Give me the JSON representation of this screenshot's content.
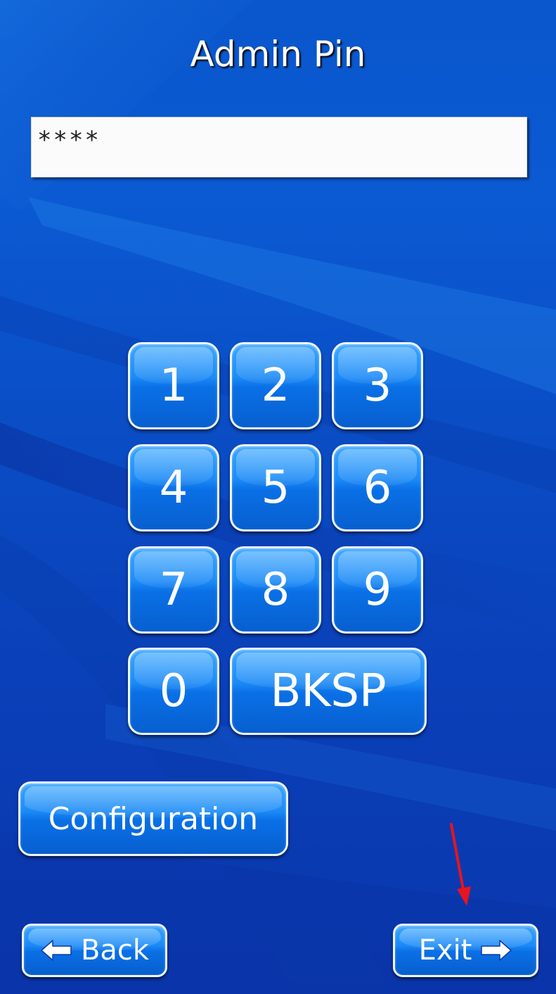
{
  "window": {
    "title": "Admin Pin"
  },
  "pin_field": {
    "value": "****"
  },
  "keypad": {
    "keys": [
      "1",
      "2",
      "3",
      "4",
      "5",
      "6",
      "7",
      "8",
      "9",
      "0"
    ],
    "backspace_label": "BKSP"
  },
  "buttons": {
    "configuration_label": "Configuration",
    "back_label": "Back",
    "exit_label": "Exit"
  },
  "icons": {
    "back": "arrow-left-icon",
    "exit": "arrow-right-icon",
    "annotation": "red-arrow-annotation-icon"
  },
  "colors": {
    "background": "#0b4fc4",
    "button_fill": "#1b8af6",
    "button_border": "#eef5ff",
    "field_fill": "#fbfbfb",
    "annotation": "#e8141e"
  }
}
